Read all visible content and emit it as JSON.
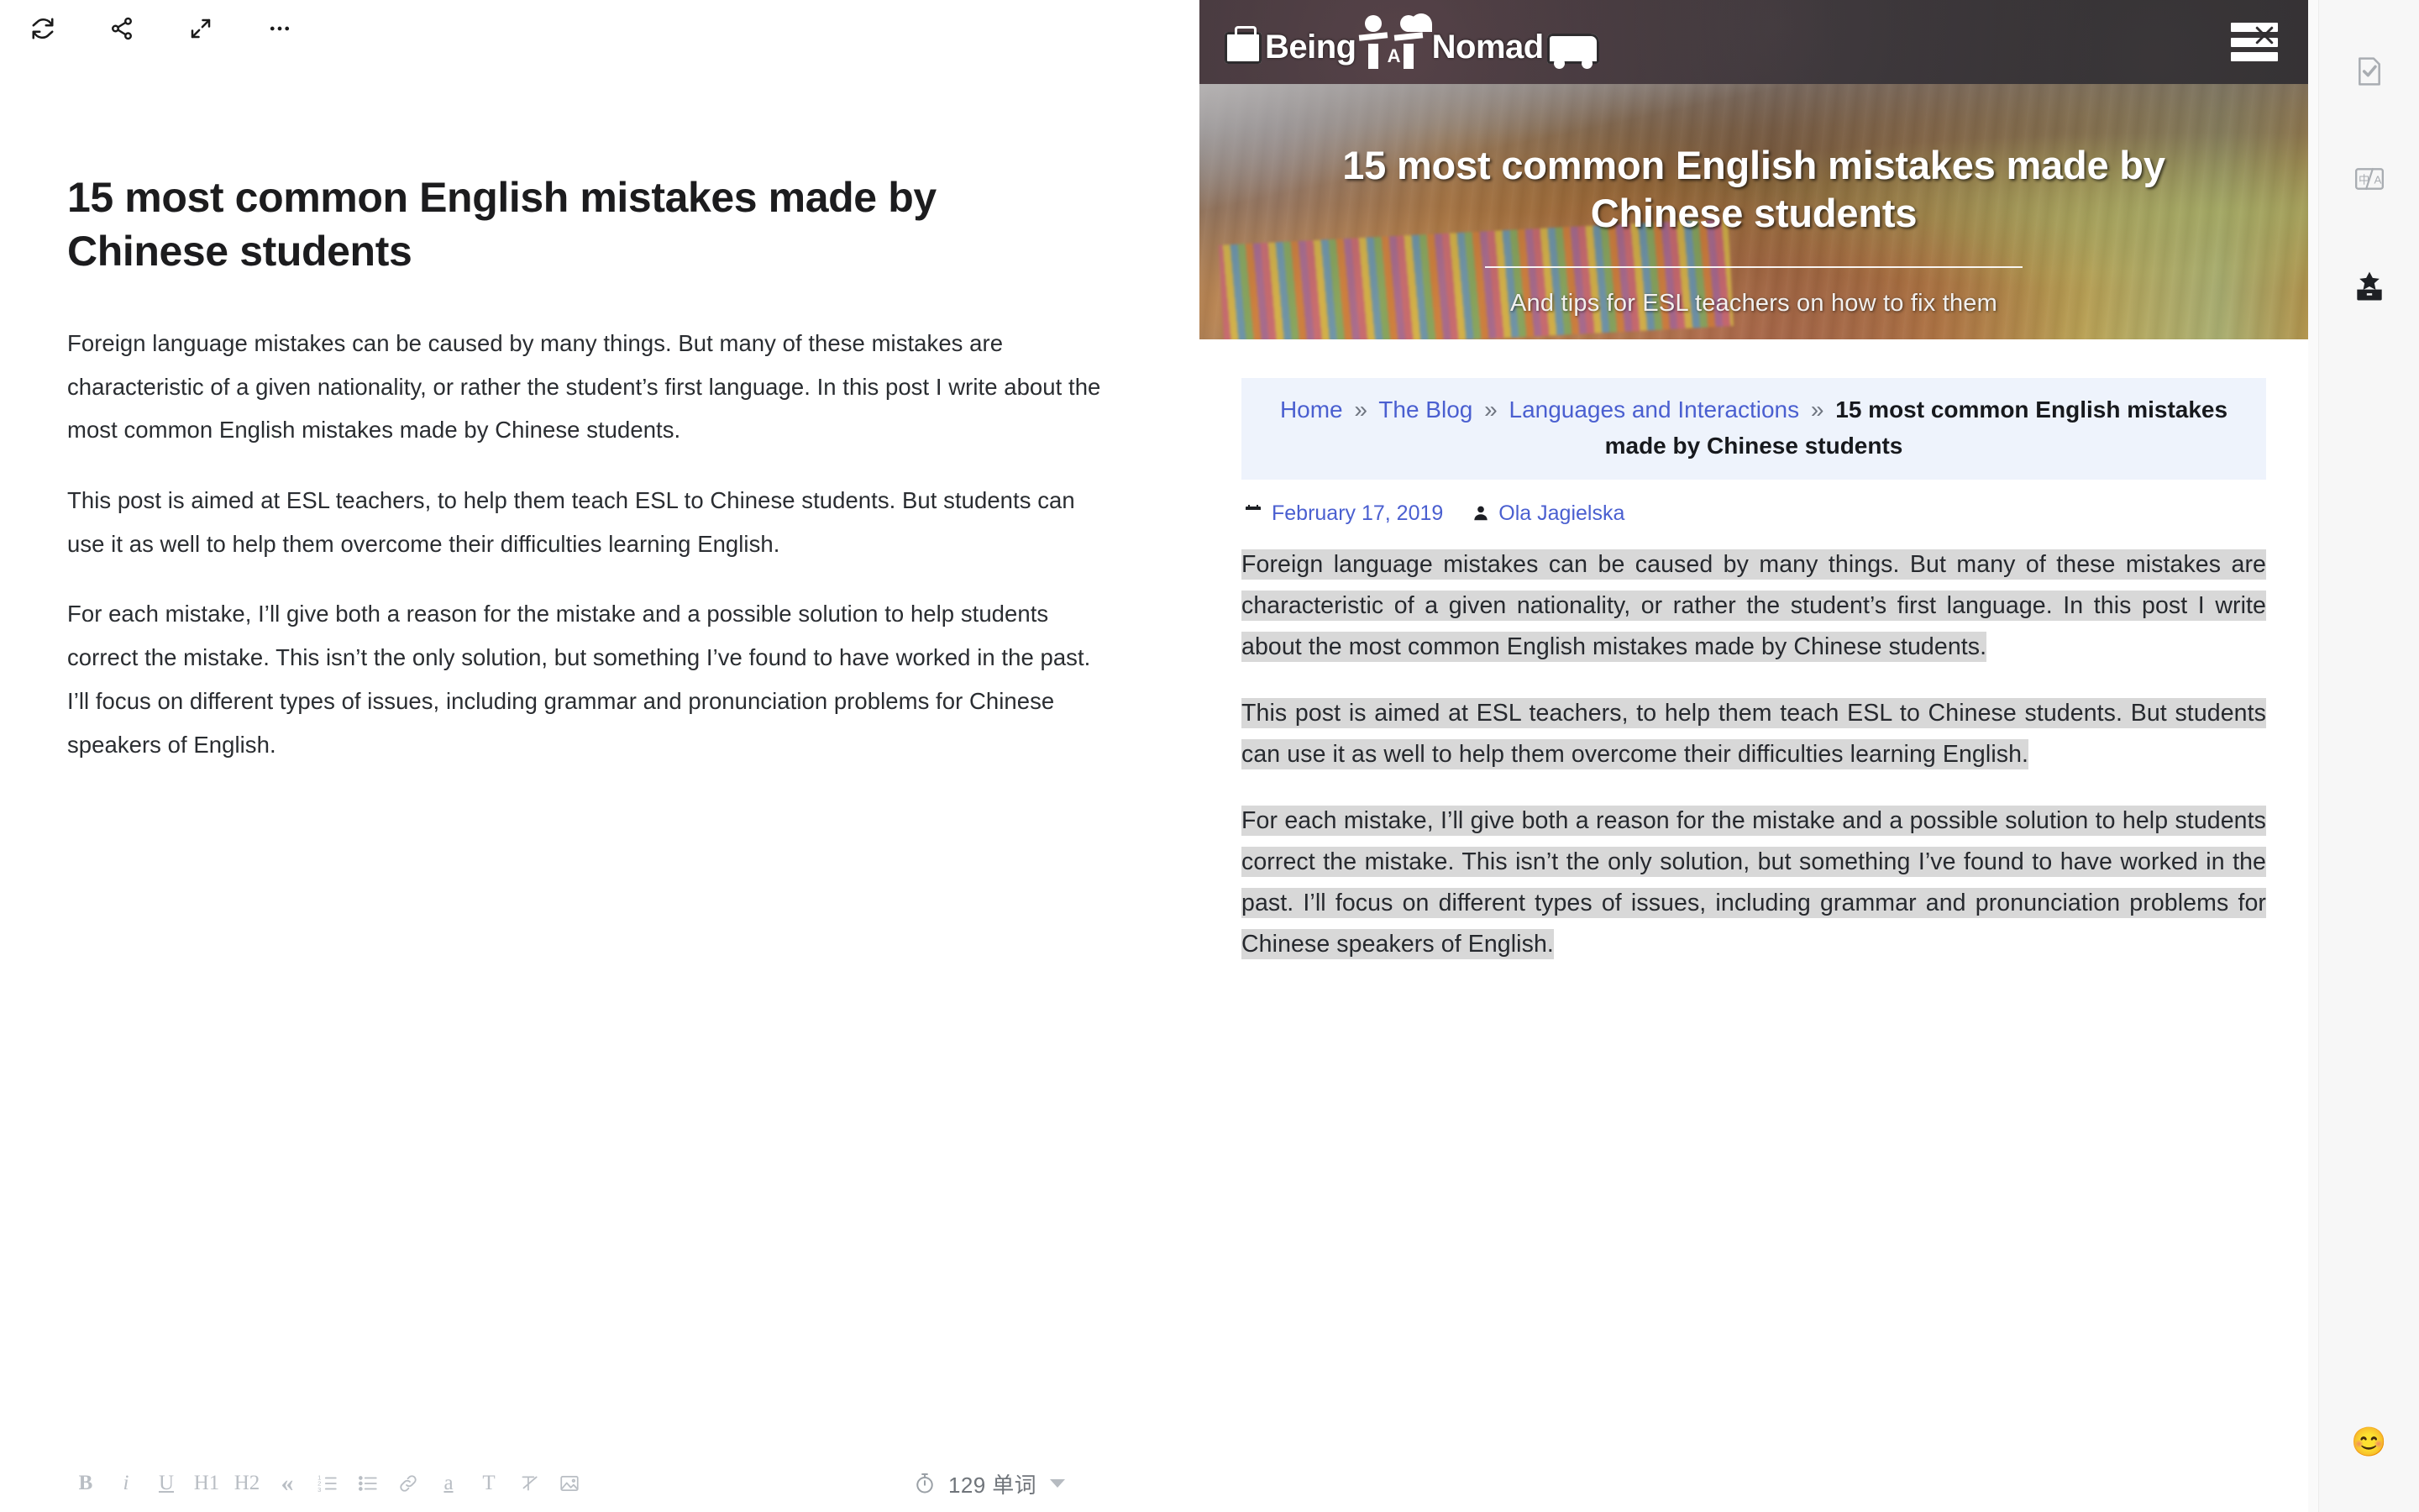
{
  "editor": {
    "toolbar_top": [
      {
        "name": "refresh-icon",
        "label": "Refresh"
      },
      {
        "name": "share-icon",
        "label": "Share"
      },
      {
        "name": "expand-icon",
        "label": "Fullscreen"
      },
      {
        "name": "more-icon",
        "label": "More"
      }
    ],
    "document": {
      "title": "15 most common English mistakes made by Chinese students",
      "paragraphs": [
        "Foreign language mistakes can be caused by many things. But many of these mistakes are characteristic of a given nationality, or rather the student’s first language. In this post I write about the most common English mistakes made by Chinese students.",
        "This post is aimed at ESL teachers, to help them teach ESL to Chinese students. But students can use it as well to help them overcome their difficulties learning English.",
        "For each mistake, I’ll give both a reason for the mistake and a possible solution to help students correct the mistake. This isn’t the only solution, but something I’ve found to have worked in the past. I’ll focus on different types of issues, including grammar and pronunciation problems for Chinese speakers of English."
      ]
    },
    "format_toolbar": [
      {
        "name": "bold-button",
        "label": "B"
      },
      {
        "name": "italic-button",
        "label": "i"
      },
      {
        "name": "underline-button",
        "label": "U"
      },
      {
        "name": "heading-1-button",
        "label": "H1"
      },
      {
        "name": "heading-2-button",
        "label": "H2"
      },
      {
        "name": "blockquote-button",
        "label": "«"
      },
      {
        "name": "ordered-list-button",
        "label": "Ordered list"
      },
      {
        "name": "bullet-list-button",
        "label": "Bullet list"
      },
      {
        "name": "link-button",
        "label": "Link"
      },
      {
        "name": "highlight-button",
        "label": "a"
      },
      {
        "name": "text-style-button",
        "label": "T"
      },
      {
        "name": "clear-format-button",
        "label": "Clear format"
      },
      {
        "name": "insert-image-button",
        "label": "Image"
      }
    ],
    "status": {
      "word_count_label": "129 单词",
      "timer_icon": "stopwatch-icon",
      "dropdown_icon": "caret-down-icon"
    }
  },
  "preview": {
    "site": {
      "logo_text_1": "Being",
      "logo_text_a": "A",
      "logo_text_2": "Nomad",
      "menu_icon": "hamburger-menu-icon"
    },
    "hero": {
      "title": "15 most common English mistakes made by Chinese students",
      "subtitle": "And tips for ESL teachers on how to fix them"
    },
    "breadcrumb": {
      "items": [
        {
          "label": "Home",
          "current": false
        },
        {
          "label": "The Blog",
          "current": false
        },
        {
          "label": "Languages and Interactions",
          "current": false
        },
        {
          "label": "15 most common English mistakes made by Chinese students",
          "current": true
        }
      ],
      "separator": "»"
    },
    "meta": {
      "date_icon": "calendar-icon",
      "date": "February 17, 2019",
      "author_icon": "user-icon",
      "author": "Ola Jagielska"
    },
    "paragraphs": [
      "Foreign language mistakes can be caused by many things. But many of these mistakes are characteristic of a given nationality, or rather the student’s first language. In this post I write about the most common English mistakes made by Chinese students.",
      "This post is aimed at ESL teachers, to help them teach ESL to Chinese students. But students can use it as well to help them overcome their difficulties learning English.",
      "For each mistake, I’ll give both a reason for the mistake and a possible solution to help students correct the mistake. This isn’t the only solution, but something I’ve found to have worked in the past. I’ll focus on different types of issues, including grammar and pronunciation problems for Chinese speakers of English."
    ]
  },
  "right_rail": {
    "buttons": [
      {
        "name": "proofread-icon",
        "label": "Proofread"
      },
      {
        "name": "translate-icon",
        "label": "Translate"
      },
      {
        "name": "toolbox-icon",
        "label": "Toolbox"
      }
    ],
    "emoji": "😊"
  },
  "colors": {
    "accent_link": "#4a5fd0",
    "breadcrumb_bg": "#eef3fc",
    "selection": "#d8d8d8",
    "header_dark": "#2e2c2e",
    "rail_bg": "#f7f7f7"
  }
}
